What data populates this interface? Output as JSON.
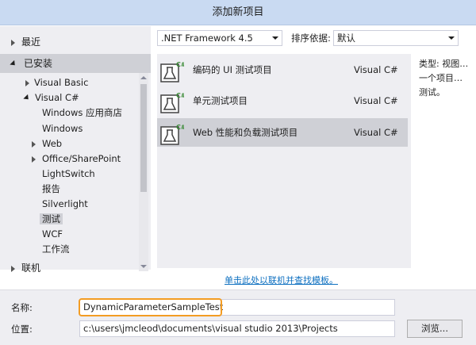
{
  "window": {
    "title": "添加新项目"
  },
  "tree": {
    "recent": "最近",
    "installed": "已安装",
    "visual_basic": "Visual Basic",
    "visual_csharp": "Visual C#",
    "children": [
      "Windows 应用商店",
      "Windows",
      "Web",
      "Office/SharePoint",
      "LightSwitch",
      "报告",
      "Silverlight",
      "测试",
      "WCF",
      "工作流"
    ],
    "selected": "测试",
    "online": "联机"
  },
  "toolbar": {
    "framework": ".NET Framework 4.5",
    "sort_label": "排序依据:",
    "sort_value": "默认"
  },
  "templates": [
    {
      "name": "编码的 UI 测试项目",
      "language": "Visual C#"
    },
    {
      "name": "单元测试项目",
      "language": "Visual C#"
    },
    {
      "name": "Web 性能和负载测试项目",
      "language": "Visual C#"
    }
  ],
  "description": {
    "line1": "类型:  视图…",
    "line2": "一个项目…",
    "line3": "测试。"
  },
  "online_link": "单击此处以联机并查找模板。",
  "form": {
    "name_label": "名称:",
    "name_value": "DynamicParameterSampleTest",
    "location_label": "位置:",
    "location_value": "c:\\users\\jmcleod\\documents\\visual studio 2013\\Projects",
    "browse_label": "浏览..."
  },
  "colors": {
    "title_bg": "#c9daf2",
    "panel_bg": "#eeeef2",
    "selection": "#cfd0d6",
    "link": "#0e70c0",
    "name_highlight": "#f39c23"
  }
}
